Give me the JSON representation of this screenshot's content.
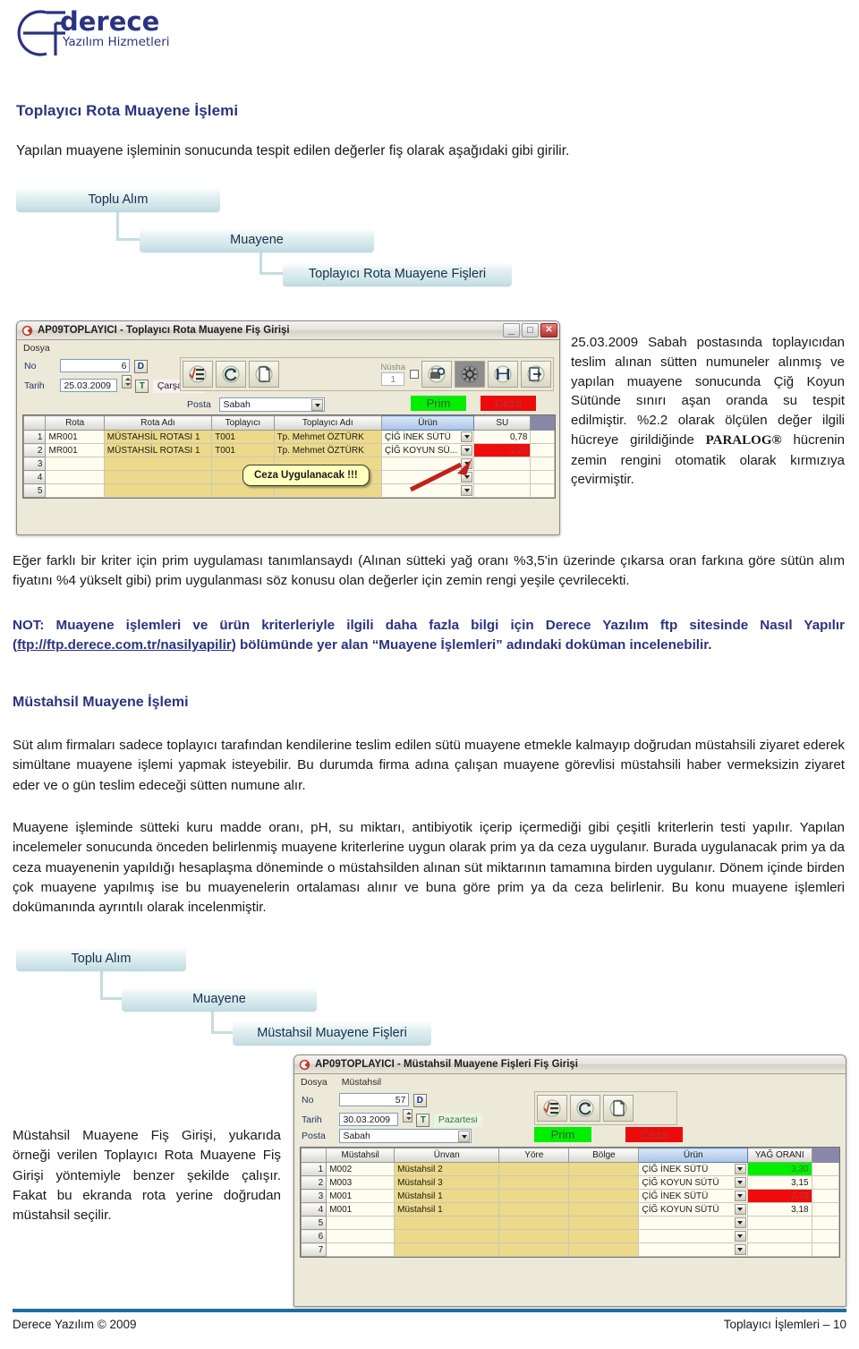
{
  "logo": {
    "brand": "derece",
    "tagline": "Yazılım Hizmetleri",
    "color": "#2b3380"
  },
  "page": {
    "title": "Toplayıcı Rota Muayene İşlemi",
    "intro": "Yapılan muayene işleminin sonucunda tespit edilen değerler fiş olarak aşağıdaki gibi girilir."
  },
  "breadcrumb_top": {
    "level1": "Toplu Alım",
    "level2": "Muayene",
    "level3": "Toplayıcı Rota Muayene Fişleri"
  },
  "breadcrumb_bottom": {
    "level1": "Toplu Alım",
    "level2": "Muayene",
    "level3": "Müstahsil Muayene Fişleri"
  },
  "window_top": {
    "title": "AP09TOPLAYICI - Toplayıcı Rota Muayene Fiş Girişi",
    "menu": [
      "Dosya"
    ],
    "minimize": "_",
    "maximize": "□",
    "close": "✕",
    "fields": {
      "no_label": "No",
      "no_value": "6",
      "d_button": "D",
      "tarih_label": "Tarih",
      "tarih_value": "25.03.2009",
      "t_button": "T",
      "day_name": "Çarşamba",
      "posta_label": "Posta",
      "posta_value": "Sabah",
      "nusha_label": "Nüsha",
      "nusha_value": "1"
    },
    "chips": {
      "prim": "Prim",
      "ceza": "Ceza"
    },
    "grid": {
      "headers": [
        "",
        "Rota",
        "Rota Adı",
        "Toplayıcı",
        "Toplayıcı Adı",
        "Ürün",
        "SU"
      ],
      "selected_header": "Ürün",
      "rows": [
        {
          "n": "1",
          "rota": "MR001",
          "rota_adi": "MÜSTAHSİL ROTASI 1",
          "toplayici": "T001",
          "toplayici_adi": "Tp. Mehmet ÖZTÜRK",
          "urun": "ÇİĞ İNEK SÜTÜ",
          "su": "0,78",
          "su_state": "normal"
        },
        {
          "n": "2",
          "rota": "MR001",
          "rota_adi": "MÜSTAHSİL ROTASI 1",
          "toplayici": "T001",
          "toplayici_adi": "Tp. Mehmet ÖZTÜRK",
          "urun": "ÇİĞ KOYUN SÜ...",
          "su": "2,20",
          "su_state": "red"
        },
        {
          "n": "3",
          "rota": "",
          "rota_adi": "",
          "toplayici": "",
          "toplayici_adi": "",
          "urun": "",
          "su": "",
          "su_state": "normal"
        },
        {
          "n": "4",
          "rota": "",
          "rota_adi": "",
          "toplayici": "",
          "toplayici_adi": "",
          "urun": "",
          "su": "",
          "su_state": "normal"
        },
        {
          "n": "5",
          "rota": "",
          "rota_adi": "",
          "toplayici": "",
          "toplayici_adi": "",
          "urun": "",
          "su": "",
          "su_state": "normal"
        }
      ]
    },
    "callout": "Ceza Uygulanacak !!!"
  },
  "window_bottom": {
    "title": "AP09TOPLAYICI - Müstahsil Muayene Fişleri Fiş Girişi",
    "menu": [
      "Dosya",
      "Müstahsil"
    ],
    "fields": {
      "no_label": "No",
      "no_value": "57",
      "d_button": "D",
      "tarih_label": "Tarih",
      "tarih_value": "30.03.2009",
      "t_button": "T",
      "day_name": "Pazartesi",
      "posta_label": "Posta",
      "posta_value": "Sabah"
    },
    "chips": {
      "prim": "Prim",
      "ceza": "Ceza"
    },
    "grid": {
      "headers": [
        "",
        "Müstahsil",
        "Ünvan",
        "Yöre",
        "Bölge",
        "Ürün",
        "YAĞ ORANI"
      ],
      "selected_header": "Ürün",
      "rows": [
        {
          "n": "1",
          "mustahsil": "M002",
          "unvan": "Müstahsil 2",
          "yore": "",
          "bolge": "",
          "urun": "ÇİĞ İNEK SÜTÜ",
          "yag": "3,30",
          "yag_state": "green"
        },
        {
          "n": "2",
          "mustahsil": "M003",
          "unvan": "Müstahsil 3",
          "yore": "",
          "bolge": "",
          "urun": "ÇİĞ KOYUN SÜTÜ",
          "yag": "3,15",
          "yag_state": "normal"
        },
        {
          "n": "3",
          "mustahsil": "M001",
          "unvan": "Müstahsil 1",
          "yore": "",
          "bolge": "",
          "urun": "ÇİĞ İNEK SÜTÜ",
          "yag": "2,78",
          "yag_state": "red"
        },
        {
          "n": "4",
          "mustahsil": "M001",
          "unvan": "Müstahsil 1",
          "yore": "",
          "bolge": "",
          "urun": "ÇİĞ KOYUN SÜTÜ",
          "yag": "3,18",
          "yag_state": "normal"
        },
        {
          "n": "5",
          "mustahsil": "",
          "unvan": "",
          "yore": "",
          "bolge": "",
          "urun": "",
          "yag": "",
          "yag_state": "normal"
        },
        {
          "n": "6",
          "mustahsil": "",
          "unvan": "",
          "yore": "",
          "bolge": "",
          "urun": "",
          "yag": "",
          "yag_state": "normal"
        },
        {
          "n": "7",
          "mustahsil": "",
          "unvan": "",
          "yore": "",
          "bolge": "",
          "urun": "",
          "yag": "",
          "yag_state": "normal"
        }
      ]
    }
  },
  "text": {
    "right_column": "25.03.2009 Sabah postasında toplayıcıdan teslim alınan sütten numuneler alınmış ve yapılan muayene sonucunda Çiğ Koyun Sütünde sınırı aşan oranda su tespit edilmiştir. %2.2 olarak ölçülen değer ilgili hücreye girildiğinde ",
    "right_column_brand": "PARALOG®",
    "right_column_tail": " hücrenin zemin rengini otomatik olarak kırmızıya çevirmiştir.",
    "para_prim": "Eğer farklı bir kriter için prim uygulaması tanımlansaydı (Alınan sütteki yağ oranı %3,5'in üzerinde çıkarsa oran farkına göre sütün alım fiyatını %4 yükselt gibi) prim uygulanması söz konusu olan değerler için zemin rengi yeşile çevrilecekti.",
    "note_pre": "NOT: Muayene işlemleri ve ürün kriterleriyle ilgili daha fazla bilgi için Derece Yazılım ftp sitesinde Nasıl Yapılır (",
    "note_link": "ftp://ftp.derece.com.tr/nasilyapilir",
    "note_post": ") bölümünde yer alan “Muayene İşlemleri” adındaki doküman incelenebilir.",
    "section2_title": "Müstahsil Muayene İşlemi",
    "para_s2_1": "Süt alım firmaları sadece toplayıcı tarafından kendilerine teslim edilen sütü muayene etmekle kalmayıp doğrudan müstahsili ziyaret ederek simültane muayene işlemi yapmak isteyebilir. Bu durumda firma adına çalışan muayene görevlisi müstahsili haber vermeksizin ziyaret eder ve o gün teslim edeceği sütten numune alır.",
    "para_s2_2": "Muayene işleminde sütteki kuru madde oranı, pH, su miktarı, antibiyotik içerip içermediği gibi çeşitli kriterlerin testi yapılır. Yapılan incelemeler sonucunda önceden belirlenmiş muayene kriterlerine uygun olarak prim ya da ceza uygulanır. Burada uygulanacak prim ya da ceza muayenenin yapıldığı hesaplaşma döneminde o müstahsilden alınan süt miktarının tamamına birden uygulanır. Dönem içinde birden çok muayene yapılmış ise bu muayenelerin ortalaması alınır ve buna göre prim ya da ceza belirlenir. Bu konu muayene işlemleri dokümanında ayrıntılı olarak incelenmiştir.",
    "para_bottom_left": "Müstahsil Muayene Fiş Girişi, yukarıda örneği verilen Toplayıcı Rota Muayene Fiş Girişi yöntemiyle benzer şekilde çalışır. Fakat bu ekranda rota yerine doğrudan müstahsil seçilir."
  },
  "footer": {
    "left": "Derece Yazılım © 2009",
    "right": "Toplayıcı İşlemleri – 10"
  }
}
